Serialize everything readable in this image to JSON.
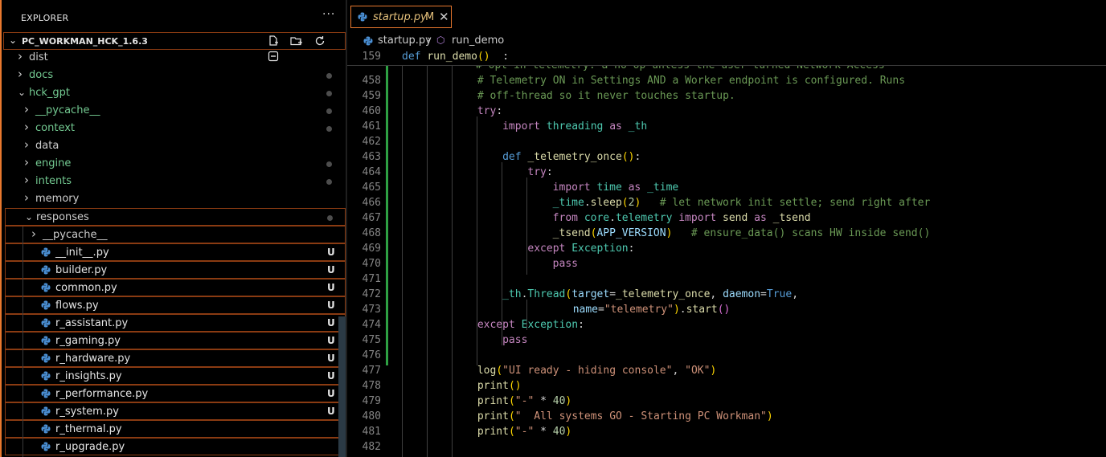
{
  "explorer": {
    "title": "EXPLORER",
    "more": "···",
    "root": "PC_WORKMAN_HCK_1.6.3",
    "items": [
      {
        "label": "dist",
        "type": "folder",
        "open": false,
        "depth": 0,
        "color": "#cccccc",
        "status": ""
      },
      {
        "label": "docs",
        "type": "folder",
        "open": false,
        "depth": 0,
        "color": "#73c991",
        "status": "dot"
      },
      {
        "label": "hck_gpt",
        "type": "folder",
        "open": true,
        "depth": 0,
        "color": "#73c991",
        "status": "dot"
      },
      {
        "label": "__pycache__",
        "type": "folder",
        "open": false,
        "depth": 1,
        "color": "#73c991",
        "status": "dot"
      },
      {
        "label": "context",
        "type": "folder",
        "open": false,
        "depth": 1,
        "color": "#73c991",
        "status": "dot"
      },
      {
        "label": "data",
        "type": "folder",
        "open": false,
        "depth": 1,
        "color": "#cccccc",
        "status": ""
      },
      {
        "label": "engine",
        "type": "folder",
        "open": false,
        "depth": 1,
        "color": "#73c991",
        "status": "dot"
      },
      {
        "label": "intents",
        "type": "folder",
        "open": false,
        "depth": 1,
        "color": "#73c991",
        "status": "dot"
      },
      {
        "label": "memory",
        "type": "folder",
        "open": false,
        "depth": 1,
        "color": "#cccccc",
        "status": ""
      },
      {
        "label": "responses",
        "type": "folder",
        "open": true,
        "depth": 1,
        "color": "#cccccc",
        "status": "dot",
        "boxed": true
      },
      {
        "label": "__pycache__",
        "type": "folder",
        "open": false,
        "depth": 2,
        "color": "#cccccc",
        "status": "",
        "boxed": true
      },
      {
        "label": "__init__.py",
        "type": "py",
        "depth": 2,
        "color": "#e5e5e5",
        "status": "U",
        "boxed": true
      },
      {
        "label": "builder.py",
        "type": "py",
        "depth": 2,
        "color": "#e5e5e5",
        "status": "U",
        "boxed": true
      },
      {
        "label": "common.py",
        "type": "py",
        "depth": 2,
        "color": "#e5e5e5",
        "status": "U",
        "boxed": true
      },
      {
        "label": "flows.py",
        "type": "py",
        "depth": 2,
        "color": "#e5e5e5",
        "status": "U",
        "boxed": true
      },
      {
        "label": "r_assistant.py",
        "type": "py",
        "depth": 2,
        "color": "#e5e5e5",
        "status": "U",
        "boxed": true
      },
      {
        "label": "r_gaming.py",
        "type": "py",
        "depth": 2,
        "color": "#e5e5e5",
        "status": "U",
        "boxed": true
      },
      {
        "label": "r_hardware.py",
        "type": "py",
        "depth": 2,
        "color": "#e5e5e5",
        "status": "U",
        "boxed": true
      },
      {
        "label": "r_insights.py",
        "type": "py",
        "depth": 2,
        "color": "#e5e5e5",
        "status": "U",
        "boxed": true
      },
      {
        "label": "r_performance.py",
        "type": "py",
        "depth": 2,
        "color": "#e5e5e5",
        "status": "U",
        "boxed": true
      },
      {
        "label": "r_system.py",
        "type": "py",
        "depth": 2,
        "color": "#e5e5e5",
        "status": "U",
        "boxed": true
      },
      {
        "label": "r_thermal.py",
        "type": "py",
        "depth": 2,
        "color": "#e5e5e5",
        "status": "",
        "boxed": true
      },
      {
        "label": "r_upgrade.py",
        "type": "py",
        "depth": 2,
        "color": "#e5e5e5",
        "status": "",
        "boxed": true
      }
    ]
  },
  "tab": {
    "title": "startup.py",
    "modified": "M",
    "close": "✕"
  },
  "breadcrumb": {
    "file": "startup.py",
    "sep": "›",
    "func": "run_demo"
  },
  "sticky": {
    "line": "159",
    "tokens": [
      [
        "d",
        "def "
      ],
      [
        "f",
        "run_demo"
      ],
      [
        "b",
        "()"
      ],
      [
        "",
        "  :"
      ]
    ]
  },
  "ghost_line": "# Opt-in telemetry: a no-op unless the user turned Network Access",
  "code_lines": [
    {
      "n": "458",
      "ind": 3,
      "tokens": [
        [
          "c",
          "# Telemetry ON in Settings AND a Worker endpoint is configured. Runs"
        ]
      ]
    },
    {
      "n": "459",
      "ind": 3,
      "tokens": [
        [
          "c",
          "# off-thread so it never touches startup."
        ]
      ]
    },
    {
      "n": "460",
      "ind": 3,
      "tokens": [
        [
          "k",
          "try"
        ],
        [
          "",
          ":"
        ]
      ]
    },
    {
      "n": "461",
      "ind": 4,
      "tokens": [
        [
          "k",
          "import "
        ],
        [
          "t",
          "threading "
        ],
        [
          "k",
          "as "
        ],
        [
          "t",
          "_th"
        ]
      ]
    },
    {
      "n": "462",
      "ind": 0,
      "tokens": []
    },
    {
      "n": "463",
      "ind": 4,
      "tokens": [
        [
          "d",
          "def "
        ],
        [
          "f",
          "_telemetry_once"
        ],
        [
          "b",
          "()"
        ],
        [
          "",
          ":"
        ]
      ]
    },
    {
      "n": "464",
      "ind": 5,
      "tokens": [
        [
          "k",
          "try"
        ],
        [
          "",
          ":"
        ]
      ]
    },
    {
      "n": "465",
      "ind": 6,
      "tokens": [
        [
          "k",
          "import "
        ],
        [
          "t",
          "time "
        ],
        [
          "k",
          "as "
        ],
        [
          "t",
          "_time"
        ]
      ]
    },
    {
      "n": "466",
      "ind": 6,
      "tokens": [
        [
          "t",
          "_time"
        ],
        [
          "",
          "."
        ],
        [
          "f",
          "sleep"
        ],
        [
          "b",
          "("
        ],
        [
          "n",
          "2"
        ],
        [
          "b",
          ")"
        ],
        [
          "",
          "   "
        ],
        [
          "c",
          "# let network init settle; send right after"
        ]
      ]
    },
    {
      "n": "467",
      "ind": 6,
      "tokens": [
        [
          "k",
          "from "
        ],
        [
          "t",
          "core"
        ],
        [
          "",
          "."
        ],
        [
          "t",
          "telemetry "
        ],
        [
          "k",
          "import "
        ],
        [
          "f",
          "send "
        ],
        [
          "k",
          "as "
        ],
        [
          "f",
          "_tsend"
        ]
      ]
    },
    {
      "n": "468",
      "ind": 6,
      "tokens": [
        [
          "f",
          "_tsend"
        ],
        [
          "b",
          "("
        ],
        [
          "v",
          "APP_VERSION"
        ],
        [
          "b",
          ")"
        ],
        [
          "",
          "   "
        ],
        [
          "c",
          "# ensure_data() scans HW inside send()"
        ]
      ]
    },
    {
      "n": "469",
      "ind": 5,
      "tokens": [
        [
          "k",
          "except "
        ],
        [
          "t",
          "Exception"
        ],
        [
          "",
          ":"
        ]
      ]
    },
    {
      "n": "470",
      "ind": 6,
      "tokens": [
        [
          "k",
          "pass"
        ]
      ]
    },
    {
      "n": "471",
      "ind": 0,
      "tokens": []
    },
    {
      "n": "472",
      "ind": 4,
      "tokens": [
        [
          "t",
          "_th"
        ],
        [
          "",
          "."
        ],
        [
          "t",
          "Thread"
        ],
        [
          "b",
          "("
        ],
        [
          "v",
          "target"
        ],
        [
          "",
          "="
        ],
        [
          "f",
          "_telemetry_once"
        ],
        [
          "",
          ", "
        ],
        [
          "v",
          "daemon"
        ],
        [
          "",
          "="
        ],
        [
          "d",
          "True"
        ],
        [
          "",
          ","
        ]
      ]
    },
    {
      "n": "473",
      "ind": 6.8,
      "tokens": [
        [
          "v",
          "name"
        ],
        [
          "",
          "="
        ],
        [
          "s",
          "\"telemetry\""
        ],
        [
          "b",
          ")"
        ],
        [
          "",
          "."
        ],
        [
          "f",
          "start"
        ],
        [
          "p",
          "()"
        ]
      ]
    },
    {
      "n": "474",
      "ind": 3,
      "tokens": [
        [
          "k",
          "except "
        ],
        [
          "t",
          "Exception"
        ],
        [
          "",
          ":"
        ]
      ]
    },
    {
      "n": "475",
      "ind": 4,
      "tokens": [
        [
          "k",
          "pass"
        ]
      ]
    },
    {
      "n": "476",
      "ind": 0,
      "tokens": []
    },
    {
      "n": "477",
      "ind": 3,
      "tokens": [
        [
          "f",
          "log"
        ],
        [
          "b",
          "("
        ],
        [
          "s",
          "\"UI ready - hiding console\""
        ],
        [
          "",
          ", "
        ],
        [
          "s",
          "\"OK\""
        ],
        [
          "b",
          ")"
        ]
      ]
    },
    {
      "n": "478",
      "ind": 3,
      "tokens": [
        [
          "f",
          "print"
        ],
        [
          "b",
          "()"
        ]
      ]
    },
    {
      "n": "479",
      "ind": 3,
      "tokens": [
        [
          "f",
          "print"
        ],
        [
          "b",
          "("
        ],
        [
          "s",
          "\"-\""
        ],
        [
          "",
          " * "
        ],
        [
          "n",
          "40"
        ],
        [
          "b",
          ")"
        ]
      ]
    },
    {
      "n": "480",
      "ind": 3,
      "tokens": [
        [
          "f",
          "print"
        ],
        [
          "b",
          "("
        ],
        [
          "s",
          "\"  All systems GO - Starting PC Workman\""
        ],
        [
          "b",
          ")"
        ]
      ]
    },
    {
      "n": "481",
      "ind": 3,
      "tokens": [
        [
          "f",
          "print"
        ],
        [
          "b",
          "("
        ],
        [
          "s",
          "\"-\""
        ],
        [
          "",
          " * "
        ],
        [
          "n",
          "40"
        ],
        [
          "b",
          ")"
        ]
      ]
    },
    {
      "n": "482",
      "ind": 0,
      "tokens": []
    }
  ],
  "colors": {
    "accent": "#e8782e",
    "added": "#2ea043",
    "untracked": "#73c991"
  },
  "icons": {
    "python": "python-file-icon",
    "new_file": "new-file-icon",
    "new_folder": "new-folder-icon",
    "refresh": "refresh-icon",
    "collapse": "collapse-all-icon"
  }
}
